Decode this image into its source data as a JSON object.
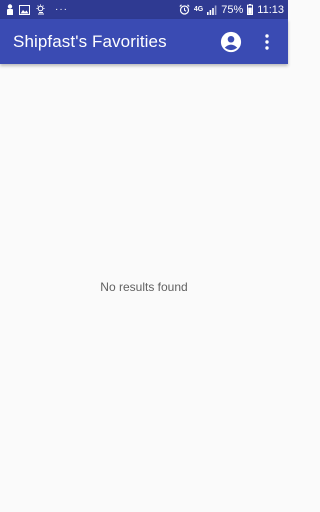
{
  "status_bar": {
    "left_icons": [
      "person-icon",
      "image-icon",
      "weather-icon"
    ],
    "more": "···",
    "network": "4G",
    "battery": "75%",
    "time": "11:13"
  },
  "app_bar": {
    "title": "Shipfast's Favorities",
    "actions": [
      "account-circle-icon",
      "more-vert-icon"
    ]
  },
  "content": {
    "empty_message": "No results found"
  },
  "colors": {
    "status_bar": "#2f3a92",
    "app_bar": "#3a4bb3",
    "background": "#fafafa",
    "text_muted": "#616161"
  }
}
